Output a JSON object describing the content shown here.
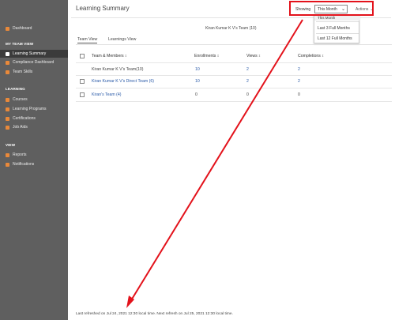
{
  "sidebar": {
    "dashboard": "Dashboard",
    "my_team_view_heading": "MY TEAM VIEW",
    "learning_summary": "Learning Summary",
    "compliance_dashboard": "Compliance Dashboard",
    "team_skills": "Team Skills",
    "learning_heading": "LEARNING",
    "courses": "Courses",
    "learning_programs": "Learning Programs",
    "certifications": "Certifications",
    "job_aids": "Job Aids",
    "view_heading": "VIEW",
    "reports": "Reports",
    "notifications": "Notifications",
    "icon_color": "#e9893a"
  },
  "header": {
    "title": "Learning Summary",
    "showing_label": "Showing",
    "selected_period": "This Month",
    "actions_label": "Actions"
  },
  "dropdown": {
    "options": [
      "This Month",
      "Last 3 Full Months",
      "Last 12 Full Months"
    ]
  },
  "main": {
    "team_caption": "Kiran Kumar K V's Team (10)",
    "tabs": [
      "Team View",
      "Learnings View"
    ],
    "columns": [
      "Team & Members",
      "Enrollments",
      "Views",
      "Completions"
    ],
    "rows": [
      {
        "name": "Kiran Kumar K V's Team(10)",
        "enrollments": "10",
        "views": "2",
        "completions": "2"
      },
      {
        "name": "Kiran Kumar K V's Direct Team (6)",
        "enrollments": "10",
        "views": "2",
        "completions": "2"
      },
      {
        "name": "Kiran's Team (4)",
        "enrollments": "0",
        "views": "0",
        "completions": "0"
      }
    ]
  },
  "footer": {
    "refresh_text": "Last refreshed on Jul 24, 2021 12:30 local time. Next refresh on Jul 25, 2021 12:30 local time."
  },
  "annotation": {
    "color": "#e3121b"
  }
}
